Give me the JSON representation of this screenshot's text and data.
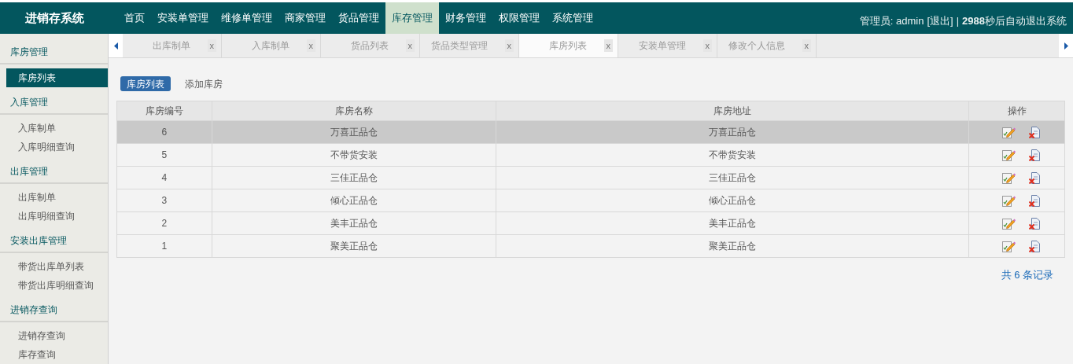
{
  "header": {
    "logo": "进销存系统",
    "nav": [
      {
        "label": "首页",
        "selected": false
      },
      {
        "label": "安装单管理",
        "selected": false
      },
      {
        "label": "维修单管理",
        "selected": false
      },
      {
        "label": "商家管理",
        "selected": false
      },
      {
        "label": "货品管理",
        "selected": false
      },
      {
        "label": "库存管理",
        "selected": true
      },
      {
        "label": "财务管理",
        "selected": false
      },
      {
        "label": "权限管理",
        "selected": false
      },
      {
        "label": "系统管理",
        "selected": false
      }
    ],
    "user_label": "管理员: admin",
    "logout": "[退出]",
    "separator": "|",
    "countdown": "2988",
    "countdown_suffix": "秒后自动退出系统"
  },
  "sidebar": {
    "groups": [
      {
        "title": "库房管理",
        "items": [
          {
            "label": "库房列表",
            "selected": true
          }
        ]
      },
      {
        "title": "入库管理",
        "items": [
          {
            "label": "入库制单",
            "selected": false
          },
          {
            "label": "入库明细查询",
            "selected": false
          }
        ]
      },
      {
        "title": "出库管理",
        "items": [
          {
            "label": "出库制单",
            "selected": false
          },
          {
            "label": "出库明细查询",
            "selected": false
          }
        ]
      },
      {
        "title": "安装出库管理",
        "items": [
          {
            "label": "带货出库单列表",
            "selected": false
          },
          {
            "label": "带货出库明细查询",
            "selected": false
          }
        ]
      },
      {
        "title": "进销存查询",
        "items": [
          {
            "label": "进销存查询",
            "selected": false
          },
          {
            "label": "库存查询",
            "selected": false
          }
        ]
      }
    ]
  },
  "tabs": [
    {
      "label": "出库制单",
      "close": "x",
      "selected": false
    },
    {
      "label": "入库制单",
      "close": "x",
      "selected": false
    },
    {
      "label": "货品列表",
      "close": "x",
      "selected": false
    },
    {
      "label": "货品类型管理",
      "close": "x",
      "selected": false
    },
    {
      "label": "库房列表",
      "close": "x",
      "selected": true
    },
    {
      "label": "安装单管理",
      "close": "x",
      "selected": false
    },
    {
      "label": "修改个人信息",
      "close": "x",
      "selected": false
    }
  ],
  "subtabs": [
    {
      "label": "库房列表",
      "selected": true
    },
    {
      "label": "添加库房",
      "selected": false
    }
  ],
  "table": {
    "columns": [
      "库房编号",
      "库房名称",
      "库房地址",
      "操作"
    ],
    "rows": [
      {
        "id": "6",
        "name": "万喜正品仓",
        "address": "万喜正品仓",
        "selected": true
      },
      {
        "id": "5",
        "name": "不带货安装",
        "address": "不带货安装",
        "selected": false
      },
      {
        "id": "4",
        "name": "三佳正品仓",
        "address": "三佳正品仓",
        "selected": false
      },
      {
        "id": "3",
        "name": "倾心正品仓",
        "address": "倾心正品仓",
        "selected": false
      },
      {
        "id": "2",
        "name": "美丰正品仓",
        "address": "美丰正品仓",
        "selected": false
      },
      {
        "id": "1",
        "name": "聚美正品仓",
        "address": "聚美正品仓",
        "selected": false
      }
    ]
  },
  "total": "共 6 条记录"
}
